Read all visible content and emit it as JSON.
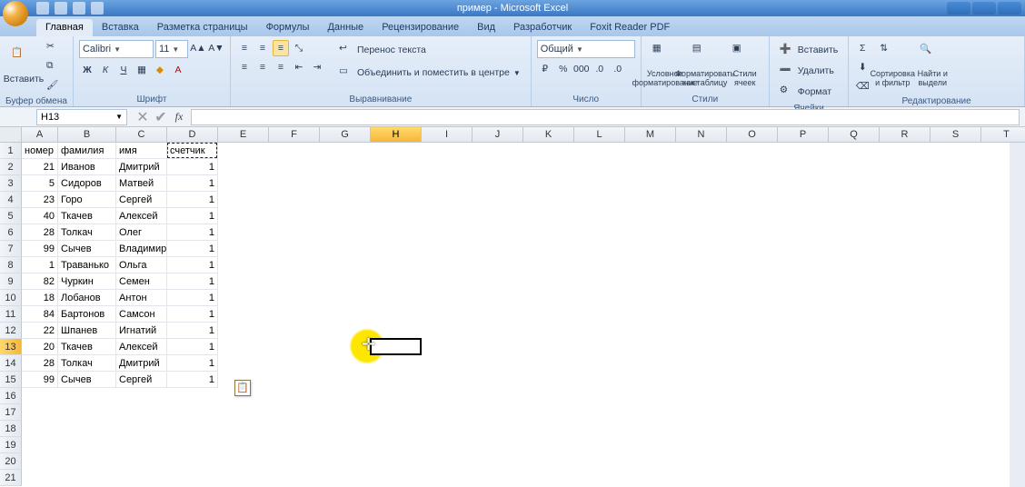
{
  "title": "пример - Microsoft Excel",
  "tabs": [
    "Главная",
    "Вставка",
    "Разметка страницы",
    "Формулы",
    "Данные",
    "Рецензирование",
    "Вид",
    "Разработчик",
    "Foxit Reader PDF"
  ],
  "active_tab_index": 0,
  "ribbon": {
    "clipboard": {
      "paste": "Вставить",
      "label": "Буфер обмена"
    },
    "font": {
      "family": "Calibri",
      "size": "11",
      "label": "Шрифт"
    },
    "alignment": {
      "wrap": "Перенос текста",
      "merge": "Объединить и поместить в центре",
      "label": "Выравнивание"
    },
    "number": {
      "format": "Общий",
      "label": "Число"
    },
    "styles": {
      "conditional": "Условное форматирование",
      "as_table": "Форматировать как таблицу",
      "cell_styles": "Стили ячеек",
      "label": "Стили"
    },
    "cells": {
      "insert": "Вставить",
      "delete": "Удалить",
      "format": "Формат",
      "label": "Ячейки"
    },
    "editing": {
      "sort": "Сортировка и фильтр",
      "find": "Найти и выдели",
      "label": "Редактирование"
    }
  },
  "namebox": "H13",
  "columns": [
    "A",
    "B",
    "C",
    "D",
    "E",
    "F",
    "G",
    "H",
    "I",
    "J",
    "K",
    "L",
    "M",
    "N",
    "O",
    "P",
    "Q",
    "R",
    "S",
    "T"
  ],
  "row_count": 21,
  "headers": {
    "A": "номер",
    "B": "фамилия",
    "C": "имя",
    "D": "счетчик"
  },
  "rows": [
    {
      "A": "21",
      "B": "Иванов",
      "C": "Дмитрий",
      "D": "1"
    },
    {
      "A": "5",
      "B": "Сидоров",
      "C": "Матвей",
      "D": "1"
    },
    {
      "A": "23",
      "B": "Горо",
      "C": "Сергей",
      "D": "1"
    },
    {
      "A": "40",
      "B": "Ткачев",
      "C": "Алексей",
      "D": "1"
    },
    {
      "A": "28",
      "B": "Толкач",
      "C": "Олег",
      "D": "1"
    },
    {
      "A": "99",
      "B": "Сычев",
      "C": "Владимир",
      "D": "1"
    },
    {
      "A": "1",
      "B": "Траванько",
      "C": "Ольга",
      "D": "1"
    },
    {
      "A": "82",
      "B": "Чуркин",
      "C": "Семен",
      "D": "1"
    },
    {
      "A": "18",
      "B": "Лобанов",
      "C": "Антон",
      "D": "1"
    },
    {
      "A": "84",
      "B": "Бартонов",
      "C": "Самсон",
      "D": "1"
    },
    {
      "A": "22",
      "B": "Шпанев",
      "C": "Игнатий",
      "D": "1"
    },
    {
      "A": "20",
      "B": "Ткачев",
      "C": "Алексей",
      "D": "1"
    },
    {
      "A": "28",
      "B": "Толкач",
      "C": "Дмитрий",
      "D": "1"
    },
    {
      "A": "99",
      "B": "Сычев",
      "C": "Сергей",
      "D": "1"
    }
  ],
  "marquee_cell": "D1",
  "active_cell": "H13",
  "selected_col": "H",
  "selected_row": 13,
  "paste_options_at": {
    "col": "D",
    "row": 16
  }
}
